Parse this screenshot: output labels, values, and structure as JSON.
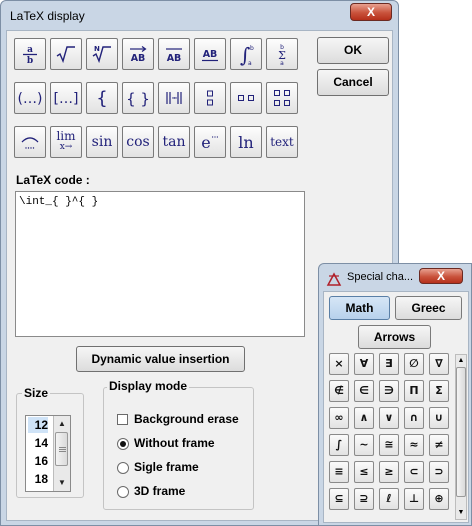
{
  "main_window": {
    "title": "LaTeX display",
    "close_label": "X",
    "toolbar_text_buttons": [
      "lim",
      "x→",
      "sin",
      "cos",
      "tan",
      "e",
      "ln",
      "text"
    ],
    "ok_label": "OK",
    "cancel_label": "Cancel",
    "code_label": "LaTeX code :",
    "code_value": "\\int_{ }^{ }",
    "dynamic_button_label": "Dynamic value insertion",
    "size": {
      "title": "Size",
      "options": [
        "12",
        "14",
        "16",
        "18"
      ],
      "selected": "12"
    },
    "display_mode": {
      "title": "Display mode",
      "background_erase_label": "Background erase",
      "background_erase_checked": false,
      "without_frame_label": "Without frame",
      "sigle_frame_label": "Sigle frame",
      "frame_3d_label": "3D frame",
      "selected": "Without frame"
    }
  },
  "special_window": {
    "title": "Special cha...",
    "close_label": "X",
    "tabs": [
      "Math",
      "Greec",
      "Arrows"
    ],
    "active_tab": "Math",
    "chars": [
      "×",
      "∀",
      "∃",
      "∅",
      "∇",
      "∉",
      "∈",
      "∋",
      "Π",
      "Σ",
      "∞",
      "∧",
      "∨",
      "∩",
      "∪",
      "∫",
      "∼",
      "≅",
      "≈",
      "≠",
      "≡",
      "≤",
      "≥",
      "⊂",
      "⊃",
      "⊆",
      "⊇",
      "ℓ",
      "⊥",
      "⊕"
    ]
  }
}
